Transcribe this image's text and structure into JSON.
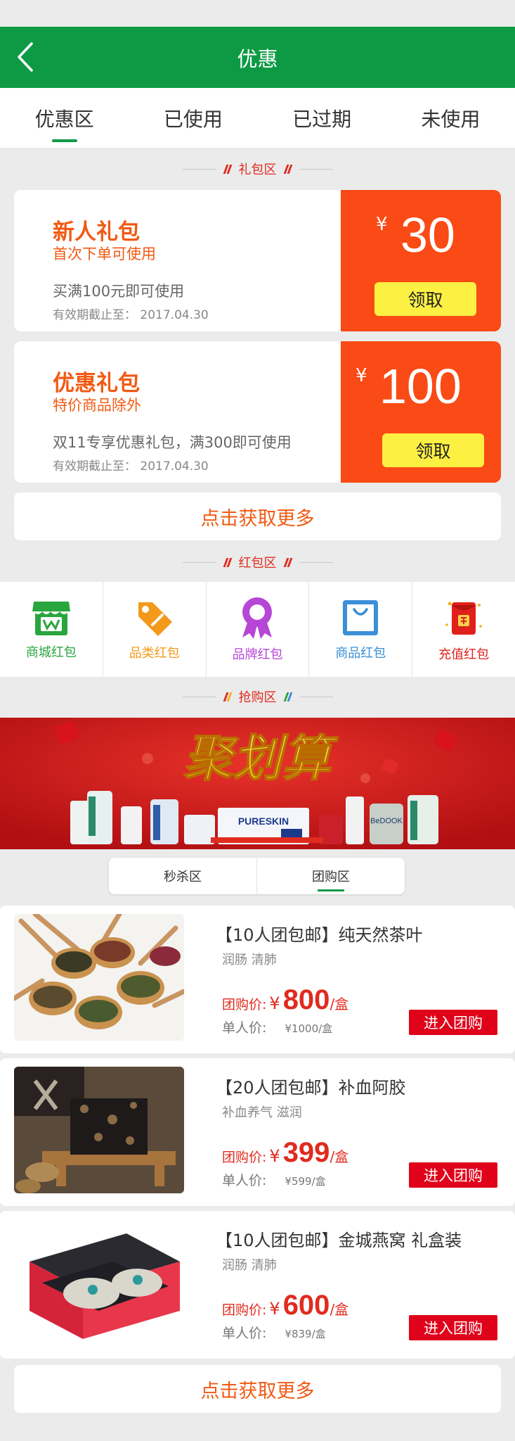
{
  "header": {
    "title": "优惠"
  },
  "tabs": [
    {
      "label": "优惠区"
    },
    {
      "label": "已使用"
    },
    {
      "label": "已过期"
    },
    {
      "label": "未使用"
    }
  ],
  "sections": {
    "gift": "礼包区",
    "redpacket": "红包区",
    "flash": "抢购区"
  },
  "coupons": [
    {
      "title": "新人礼包",
      "subtitle": "首次下单可使用",
      "desc": "买满100元即可使用",
      "expiry": "有效期截止至： 2017.04.30",
      "currency": "¥",
      "amount": "30",
      "button": "领取"
    },
    {
      "title": "优惠礼包",
      "subtitle": "特价商品除外",
      "desc": "双11专享优惠礼包，满300即可使用",
      "expiry": "有效期截止至： 2017.04.30",
      "currency": "¥",
      "amount": "100",
      "button": "领取"
    }
  ],
  "more_label": "点击获取更多",
  "categories": [
    {
      "label": "商城红包",
      "icon": "shop-icon",
      "color": "#2aa63f"
    },
    {
      "label": "品类红包",
      "icon": "tag-icon",
      "color": "#f39a1a"
    },
    {
      "label": "品牌红包",
      "icon": "badge-icon",
      "color": "#b646d6"
    },
    {
      "label": "商品红包",
      "icon": "bag-icon",
      "color": "#3a8fd6"
    },
    {
      "label": "充值红包",
      "icon": "red-envelope-icon",
      "color": "#e0201a"
    }
  ],
  "banner": {
    "headline": "聚划算",
    "brand_a": "PURESKIN",
    "brand_b": "BeDOOK"
  },
  "switch": [
    {
      "label": "秒杀区"
    },
    {
      "label": "团购区"
    }
  ],
  "products": [
    {
      "name": "【10人团包邮】纯天然茶叶",
      "tags": "润肠   清肺",
      "group_label": "团购价:",
      "currency": "¥",
      "group_price": "800",
      "unit": "/盒",
      "single_label": "单人价:",
      "single_price": "¥1000/盒",
      "button": "进入团购"
    },
    {
      "name": "【20人团包邮】补血阿胶",
      "tags": "补血养气   滋润",
      "group_label": "团购价:",
      "currency": "¥",
      "group_price": "399",
      "unit": "/盒",
      "single_label": "单人价:",
      "single_price": "¥599/盒",
      "button": "进入团购"
    },
    {
      "name": "【10人团包邮】金城燕窝 礼盒装",
      "tags": "润肠   清肺",
      "group_label": "团购价:",
      "currency": "¥",
      "group_price": "600",
      "unit": "/盒",
      "single_label": "单人价:",
      "single_price": "¥839/盒",
      "button": "进入团购"
    }
  ],
  "colors": {
    "brand_green": "#0e9a44",
    "coupon_orange": "#fa4a15",
    "accent_red": "#e02b1f",
    "button_yellow": "#fcf043"
  }
}
